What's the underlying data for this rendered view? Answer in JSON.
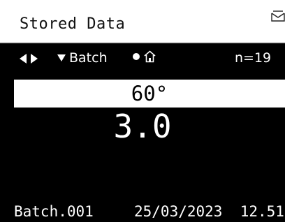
{
  "header": {
    "title": "Stored Data",
    "icon": "tray-icon"
  },
  "status_bar": {
    "nav_icon": "left-right-arrows-icon",
    "filter_icon": "down-triangle-icon",
    "filter_label": "Batch",
    "indicator_icon": "filled-dot-icon",
    "home_icon": "home-icon",
    "count": "n=19"
  },
  "measurement": {
    "angle": "60°",
    "value": "3.0"
  },
  "footer": {
    "batch_name": "Batch.001",
    "date": "25/03/2023",
    "time": "12.51"
  },
  "colors": {
    "screen_background": "#000000",
    "text_on_screen": "#ffffff",
    "title_bar": "#ffffff",
    "angle_bar": "#ffffff"
  }
}
